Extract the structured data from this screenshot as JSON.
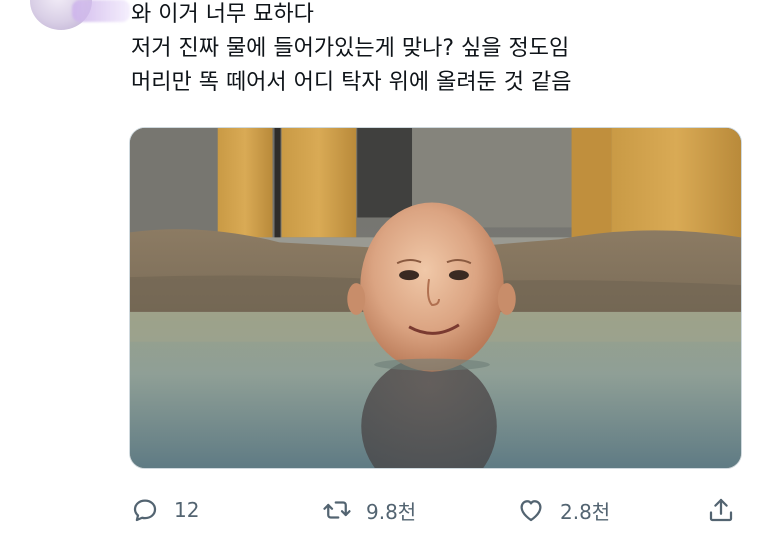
{
  "tweet": {
    "lines": [
      "와 이거 너무 묘하다",
      "저거 진짜 물에 들어가있는게 맞나? 싶을 정도임",
      "머리만 똑 떼어서 어디 탁자 위에 올려둔 것 같음"
    ]
  },
  "actions": {
    "reply_count": "12",
    "retweet_count": "9.8천",
    "like_count": "2.8천",
    "icons": {
      "reply": "reply-bubble-icon",
      "retweet": "retweet-icon",
      "like": "heart-icon",
      "share": "share-icon"
    }
  },
  "colors": {
    "text": "#0f1419",
    "muted": "#536471",
    "border": "#cfd9de"
  }
}
